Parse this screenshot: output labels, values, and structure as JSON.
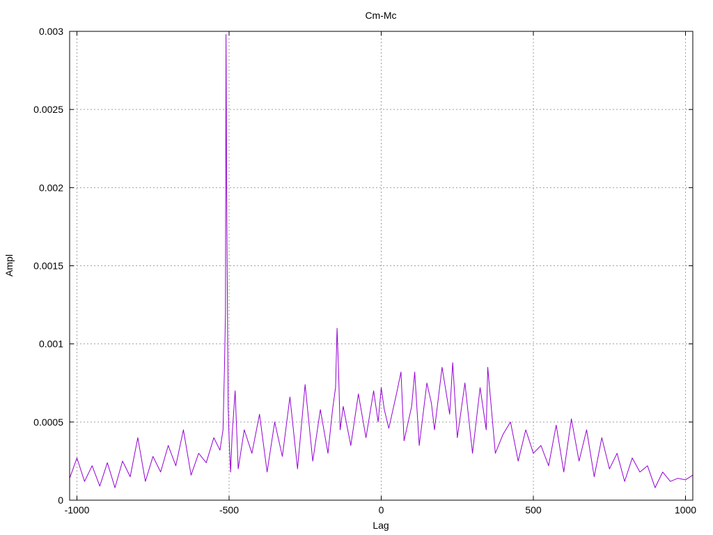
{
  "chart_data": {
    "type": "line",
    "title": "Cm-Mc",
    "xlabel": "Lag",
    "ylabel": "Ampl",
    "xlim": [
      -1024,
      1024
    ],
    "ylim": [
      0,
      0.003
    ],
    "grid": true,
    "legend": "none",
    "line_color": "#9400d3",
    "x_ticks": [
      {
        "value": -1000,
        "label": "-1000"
      },
      {
        "value": -500,
        "label": "-500"
      },
      {
        "value": 0,
        "label": "0"
      },
      {
        "value": 500,
        "label": "500"
      },
      {
        "value": 1000,
        "label": "1000"
      }
    ],
    "y_ticks": [
      {
        "value": 0,
        "label": "0"
      },
      {
        "value": 0.0005,
        "label": "0.0005"
      },
      {
        "value": 0.001,
        "label": "0.001"
      },
      {
        "value": 0.0015,
        "label": "0.0015"
      },
      {
        "value": 0.002,
        "label": "0.002"
      },
      {
        "value": 0.0025,
        "label": "0.0025"
      },
      {
        "value": 0.003,
        "label": "0.003"
      }
    ],
    "series": [
      {
        "x": [
          -1024,
          -1000,
          -975,
          -950,
          -925,
          -900,
          -875,
          -850,
          -825,
          -800,
          -775,
          -750,
          -725,
          -700,
          -675,
          -650,
          -625,
          -600,
          -575,
          -550,
          -530,
          -520,
          -515,
          -512,
          -510,
          -508,
          -505,
          -503,
          -500,
          -495,
          -490,
          -480,
          -470,
          -450,
          -425,
          -400,
          -375,
          -350,
          -325,
          -300,
          -275,
          -250,
          -225,
          -200,
          -175,
          -160,
          -150,
          -145,
          -140,
          -135,
          -125,
          -100,
          -75,
          -50,
          -25,
          -10,
          0,
          10,
          25,
          50,
          65,
          75,
          100,
          110,
          125,
          150,
          165,
          175,
          200,
          225,
          235,
          250,
          275,
          300,
          325,
          345,
          350,
          375,
          400,
          425,
          450,
          475,
          500,
          525,
          550,
          575,
          600,
          625,
          650,
          675,
          700,
          725,
          750,
          775,
          800,
          825,
          850,
          875,
          900,
          925,
          950,
          975,
          1000,
          1024
        ],
        "y": [
          0.00014,
          0.00027,
          0.00012,
          0.00022,
          9e-05,
          0.00024,
          8e-05,
          0.00025,
          0.00015,
          0.0004,
          0.00012,
          0.00028,
          0.00018,
          0.00035,
          0.00022,
          0.00045,
          0.00016,
          0.0003,
          0.00024,
          0.0004,
          0.00032,
          0.00045,
          0.00085,
          0.0012,
          0.00298,
          0.002,
          0.00115,
          0.0006,
          0.0004,
          0.00018,
          0.00042,
          0.0007,
          0.0002,
          0.00045,
          0.0003,
          0.00055,
          0.00018,
          0.0005,
          0.00028,
          0.00066,
          0.0002,
          0.00074,
          0.00025,
          0.00058,
          0.0003,
          0.00058,
          0.00072,
          0.0011,
          0.00082,
          0.00045,
          0.0006,
          0.00035,
          0.00068,
          0.0004,
          0.0007,
          0.0005,
          0.00072,
          0.00058,
          0.00046,
          0.00068,
          0.00082,
          0.00038,
          0.0006,
          0.00082,
          0.00035,
          0.00075,
          0.00062,
          0.00045,
          0.00085,
          0.00055,
          0.00088,
          0.0004,
          0.00075,
          0.0003,
          0.00072,
          0.00045,
          0.00085,
          0.0003,
          0.00042,
          0.0005,
          0.00025,
          0.00045,
          0.0003,
          0.00035,
          0.00022,
          0.00048,
          0.00018,
          0.00052,
          0.00025,
          0.00045,
          0.00015,
          0.0004,
          0.0002,
          0.0003,
          0.00012,
          0.00027,
          0.00018,
          0.00022,
          8e-05,
          0.00018,
          0.00012,
          0.00014,
          0.00013,
          0.00016
        ]
      }
    ]
  }
}
